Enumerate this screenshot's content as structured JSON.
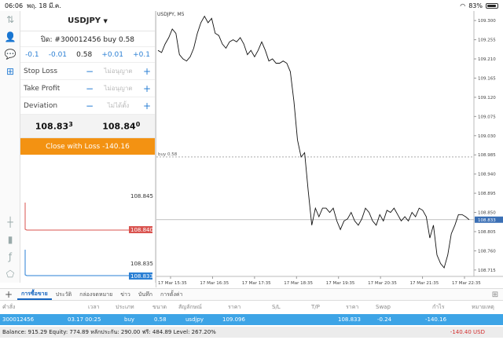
{
  "status": {
    "time": "06:06",
    "date": "พฤ. 18 มี.ค.",
    "battery": "83%"
  },
  "panel": {
    "symbol": "USDJPY",
    "order": "ปิด: #300012456 buy 0.58",
    "steps": [
      "-0.1",
      "-0.01",
      "0.58",
      "+0.01",
      "+0.1"
    ],
    "fields": [
      {
        "label": "Stop Loss",
        "placeholder": "ไม่อนุญาต"
      },
      {
        "label": "Take Profit",
        "placeholder": "ไม่อนุญาต"
      },
      {
        "label": "Deviation",
        "placeholder": "ไม่ได้ตั้ง"
      }
    ],
    "bid": {
      "main": "108.83",
      "sup": "3"
    },
    "ask": {
      "main": "108.84",
      "sup": "0"
    },
    "close_label": "Close with Loss -140.16",
    "mini": {
      "top_label": "108.845",
      "low_label": "108.835",
      "red_tag": "108.840",
      "blue_tag": "108.833"
    }
  },
  "chart": {
    "title": "USDJPY, M5",
    "order_line_label": "buy 0.58",
    "current_tag": "108.833"
  },
  "chart_data": {
    "type": "line",
    "symbol": "USDJPY",
    "timeframe": "M5",
    "x": [
      "17 Mar 15:35",
      "17 Mar 16:35",
      "17 Mar 17:35",
      "17 Mar 18:35",
      "17 Mar 19:35",
      "17 Mar 20:35",
      "17 Mar 21:35",
      "17 Mar 22:35"
    ],
    "y_ticks": [
      "109.300",
      "109.255",
      "109.210",
      "109.165",
      "109.120",
      "109.075",
      "109.030",
      "108.985",
      "108.940",
      "108.895",
      "108.850",
      "108.805",
      "108.760",
      "108.715"
    ],
    "series": [
      {
        "values": [
          109.23,
          109.225,
          109.245,
          109.26,
          109.28,
          109.27,
          109.22,
          109.21,
          109.205,
          109.215,
          109.235,
          109.27,
          109.295,
          109.31,
          109.295,
          109.305,
          109.27,
          109.265,
          109.245,
          109.235,
          109.25,
          109.255,
          109.25,
          109.26,
          109.245,
          109.22,
          109.23,
          109.215,
          109.23,
          109.25,
          109.23,
          109.205,
          109.21,
          109.2,
          109.2,
          109.205,
          109.2,
          109.18,
          109.11,
          109.02,
          108.98,
          108.99,
          108.9,
          108.82,
          108.86,
          108.84,
          108.86,
          108.86,
          108.85,
          108.86,
          108.83,
          108.81,
          108.83,
          108.835,
          108.85,
          108.83,
          108.82,
          108.835,
          108.86,
          108.85,
          108.83,
          108.82,
          108.845,
          108.83,
          108.855,
          108.85,
          108.86,
          108.845,
          108.83,
          108.84,
          108.83,
          108.85,
          108.84,
          108.86,
          108.855,
          108.84,
          108.79,
          108.82,
          108.75,
          108.73,
          108.72,
          108.75,
          108.8,
          108.82,
          108.845,
          108.845,
          108.84,
          108.833
        ]
      }
    ],
    "order_line": 108.98,
    "current_price": 108.833
  },
  "tabs": [
    "การซื้อขาย",
    "ประวัติ",
    "กล่องจดหมาย",
    "ข่าว",
    "บันทึก",
    "การตั้งค่า"
  ],
  "table": {
    "headers": [
      "คำสั่ง",
      "เวลา",
      "ประเภท",
      "ขนาด",
      "สัญลักษณ์",
      "ราคา",
      "S/L",
      "T/P",
      "ราคา",
      "Swap",
      "กำไร",
      "หมายเหตุ"
    ],
    "row": [
      "300012456",
      "03.17 00:25",
      "buy",
      "0.58",
      "usdjpy",
      "109.096",
      "",
      "",
      "108.833",
      "-0.24",
      "-140.16",
      ""
    ]
  },
  "balance": {
    "text": "Balance: 915.29 Equity: 774.89 หลักประกัน: 290.00 ฟรี: 484.89 Level: 267.20%",
    "pnl": "-140.40  USD"
  }
}
